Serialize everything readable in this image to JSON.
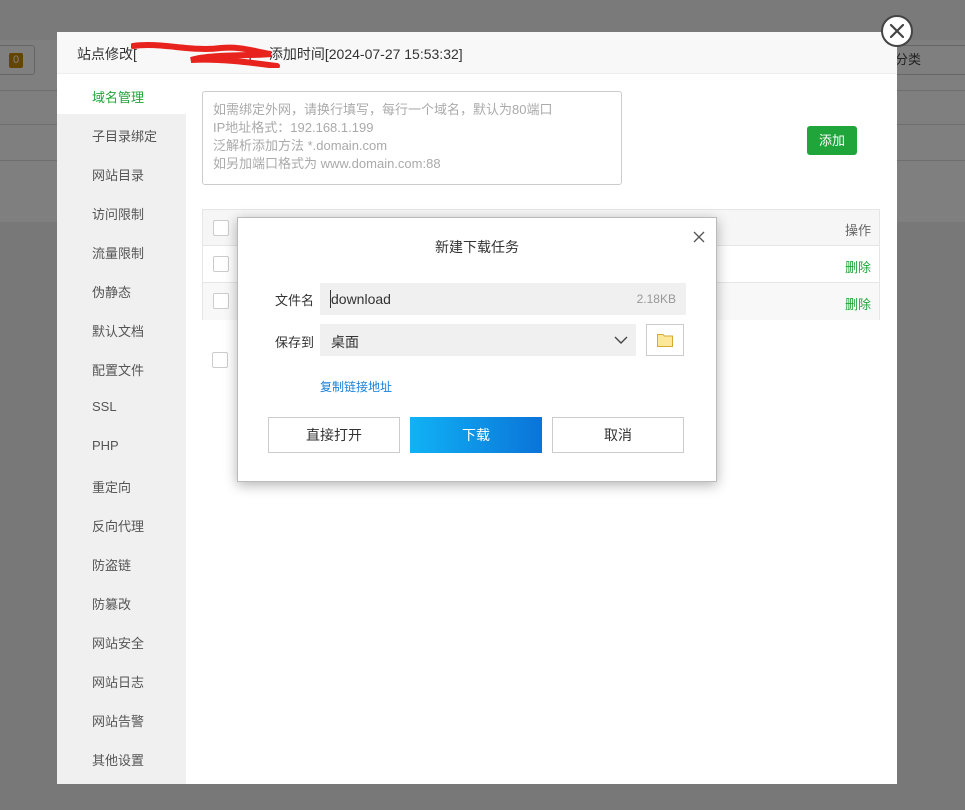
{
  "background": {
    "toolbar_count": "0",
    "right_tool_label": "分类"
  },
  "modal": {
    "title_prefix": "站点修改[",
    "title_suffix": "] -- 添加时间[2024-07-27 15:53:32]",
    "sidebar": [
      {
        "label": "域名管理",
        "active": true
      },
      {
        "label": "子目录绑定"
      },
      {
        "label": "网站目录"
      },
      {
        "label": "访问限制"
      },
      {
        "label": "流量限制"
      },
      {
        "label": "伪静态"
      },
      {
        "label": "默认文档"
      },
      {
        "label": "配置文件"
      },
      {
        "label": "SSL"
      },
      {
        "label": "PHP"
      },
      {
        "label": "重定向"
      },
      {
        "label": "反向代理"
      },
      {
        "label": "防盗链"
      },
      {
        "label": "防篡改"
      },
      {
        "label": "网站安全"
      },
      {
        "label": "网站日志"
      },
      {
        "label": "网站告警"
      },
      {
        "label": "其他设置"
      }
    ],
    "domain_input": {
      "placeholder_lines": [
        "如需绑定外网，请换行填写，每行一个域名，默认为80端口",
        "IP地址格式：192.168.1.199",
        "泛解析添加方法 *.domain.com",
        "如另加端口格式为 www.domain.com:88"
      ]
    },
    "add_button": "添加",
    "table": {
      "header_op": "操作",
      "rows": [
        {
          "action": "删除"
        },
        {
          "action": "删除"
        }
      ]
    }
  },
  "download_dialog": {
    "title": "新建下载任务",
    "filename_label": "文件名",
    "filename_value": "download",
    "file_size": "2.18KB",
    "save_label": "保存到",
    "save_value": "桌面",
    "copy_link": "复制链接地址",
    "buttons": {
      "open": "直接打开",
      "download": "下载",
      "cancel": "取消"
    }
  }
}
